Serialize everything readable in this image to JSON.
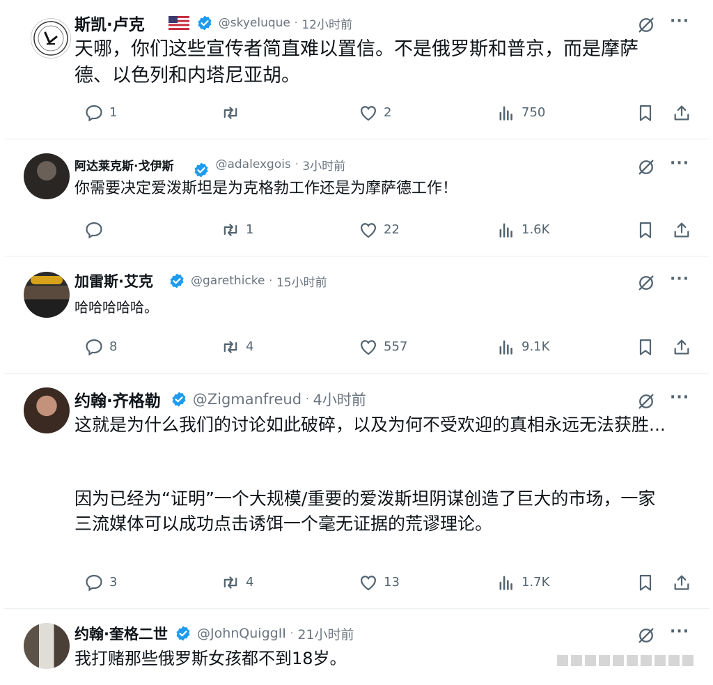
{
  "posts": [
    {
      "author": "斯凯·卢克",
      "handle": "@skyeluque",
      "time": "12小时前",
      "text": "天哪，你们这些宣传者简直难以置信。不是俄罗斯和普京，而是摩萨德、以色列和内塔尼亚胡。",
      "replies": "1",
      "retweets": "",
      "likes": "2",
      "views": "750"
    },
    {
      "author": "阿达莱克斯·戈伊斯",
      "handle": "@adalexgois",
      "time": "3小时前",
      "text": "你需要决定爱泼斯坦是为克格勃工作还是为摩萨德工作！",
      "replies": "",
      "retweets": "1",
      "likes": "22",
      "views": "1.6K"
    },
    {
      "author": "加雷斯·艾克",
      "handle": "@garethicke",
      "time": "15小时前",
      "text": "哈哈哈哈哈。",
      "replies": "8",
      "retweets": "4",
      "likes": "557",
      "views": "9.1K"
    },
    {
      "author": "约翰·齐格勒",
      "handle": "@Zigmanfreud",
      "time": "4小时前",
      "text1": "这就是为什么我们的讨论如此破碎，以及为何不受欢迎的真相永远无法获胜...",
      "text2": "因为已经为“证明”一个大规模/重要的爱泼斯坦阴谋创造了巨大的市场，一家三流媒体可以成功点击诱饵一个毫无证据的荒谬理论。",
      "replies": "3",
      "retweets": "4",
      "likes": "13",
      "views": "1.7K"
    },
    {
      "author": "约翰·奎格二世",
      "handle": "@JohnQuiggII",
      "time": "21小时前",
      "text": "我打赌那些俄罗斯女孩都不到18岁。"
    }
  ],
  "colors": {
    "verified": "#1d9bf0",
    "text": "#0f1419",
    "muted": "#536471"
  },
  "icons": [
    "reply-icon",
    "retweet-icon",
    "like-icon",
    "views-icon",
    "bookmark-icon",
    "share-icon",
    "grok-icon",
    "more-icon",
    "verified-badge-icon",
    "us-flag-icon"
  ]
}
